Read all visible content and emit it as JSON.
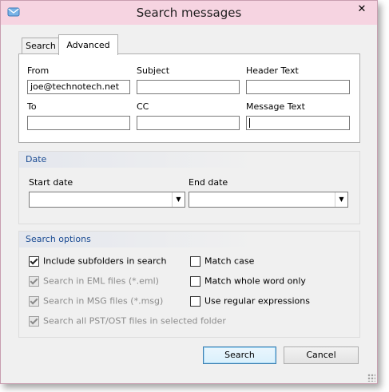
{
  "window": {
    "title": "Search messages",
    "close_glyph": "✕"
  },
  "tabs": [
    {
      "label": "Search",
      "active": false
    },
    {
      "label": "Advanced",
      "active": true
    }
  ],
  "advanced": {
    "fields": [
      {
        "label": "From",
        "value": "joe@technotech.net"
      },
      {
        "label": "Subject",
        "value": ""
      },
      {
        "label": "Header Text",
        "value": ""
      },
      {
        "label": "To",
        "value": ""
      },
      {
        "label": "CC",
        "value": ""
      },
      {
        "label": "Message Text",
        "value": ""
      }
    ]
  },
  "date_group": {
    "title": "Date",
    "start_label": "Start date",
    "start_value": "",
    "end_label": "End date",
    "end_value": ""
  },
  "options_group": {
    "title": "Search options",
    "left": [
      {
        "label": "Include subfolders in search",
        "checked": true,
        "enabled": true
      },
      {
        "label": "Search in EML files (*.eml)",
        "checked": true,
        "enabled": false
      },
      {
        "label": "Search in MSG files (*.msg)",
        "checked": true,
        "enabled": false
      },
      {
        "label": "Search all PST/OST files in selected folder",
        "checked": true,
        "enabled": false
      }
    ],
    "right": [
      {
        "label": "Match case",
        "checked": false,
        "enabled": true
      },
      {
        "label": "Match whole word only",
        "checked": false,
        "enabled": true
      },
      {
        "label": "Use regular expressions",
        "checked": false,
        "enabled": true
      }
    ]
  },
  "buttons": {
    "search": "Search",
    "cancel": "Cancel"
  },
  "icons": {
    "app": "search-envelope-icon",
    "close": "close-icon"
  },
  "colors": {
    "titlebar": "#f6d4e1",
    "group_title": "#1a4b93",
    "border": "#c89eb0"
  }
}
